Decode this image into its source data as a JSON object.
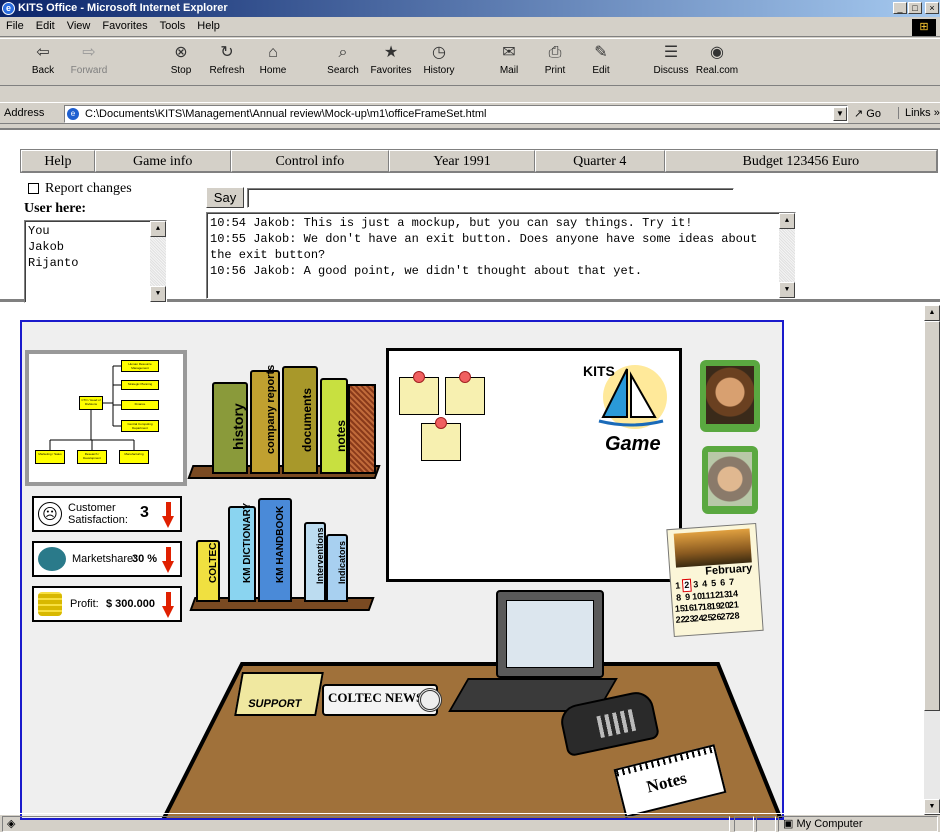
{
  "window": {
    "title": "KITS Office - Microsoft Internet Explorer"
  },
  "menu": [
    "File",
    "Edit",
    "View",
    "Favorites",
    "Tools",
    "Help"
  ],
  "toolbar": [
    {
      "label": "Back",
      "icon": "back-arrow-icon",
      "glyph": "⇦",
      "enabled": true
    },
    {
      "label": "Forward",
      "icon": "forward-arrow-icon",
      "glyph": "⇨",
      "enabled": false
    },
    {
      "label": "Stop",
      "icon": "stop-icon",
      "glyph": "⊗",
      "enabled": true
    },
    {
      "label": "Refresh",
      "icon": "refresh-icon",
      "glyph": "↻",
      "enabled": true
    },
    {
      "label": "Home",
      "icon": "home-icon",
      "glyph": "⌂",
      "enabled": true
    },
    {
      "label": "Search",
      "icon": "search-icon",
      "glyph": "⌕",
      "enabled": true
    },
    {
      "label": "Favorites",
      "icon": "favorites-icon",
      "glyph": "★",
      "enabled": true
    },
    {
      "label": "History",
      "icon": "history-icon",
      "glyph": "◷",
      "enabled": true
    },
    {
      "label": "Mail",
      "icon": "mail-icon",
      "glyph": "✉",
      "enabled": true
    },
    {
      "label": "Print",
      "icon": "print-icon",
      "glyph": "⎙",
      "enabled": true
    },
    {
      "label": "Edit",
      "icon": "edit-icon",
      "glyph": "✎",
      "enabled": true
    },
    {
      "label": "Discuss",
      "icon": "discuss-icon",
      "glyph": "☰",
      "enabled": true
    },
    {
      "label": "Real.com",
      "icon": "realcom-icon",
      "glyph": "◉",
      "enabled": true
    }
  ],
  "address": {
    "label": "Address",
    "url": "C:\\Documents\\KITS\\Management\\Annual review\\Mock-up\\m1\\officeFrameSet.html",
    "go": "Go",
    "links": "Links"
  },
  "nav": {
    "help": "Help",
    "game_info": "Game info",
    "control_info": "Control info",
    "year": "Year 1991",
    "quarter": "Quarter 4",
    "budget": "Budget 123456 Euro"
  },
  "report_changes": "Report changes",
  "users": {
    "label": "User here:",
    "list": [
      "You",
      "Jakob",
      "Rijanto"
    ]
  },
  "say": {
    "button": "Say",
    "value": ""
  },
  "chat": [
    "10:54 Jakob: This is just a mockup, but you can say things. Try it!",
    "10:55 Jakob: We don't have an exit button. Does anyone have some ideas about the exit button?",
    "10:56 Jakob: A good point, we didn't thought about that yet."
  ],
  "office": {
    "books_top": [
      "history",
      "company reports",
      "documents",
      "notes"
    ],
    "books_bottom": [
      "COLTEC",
      "KM DICTIONARY",
      "KM HANDBOOK",
      "Interventions",
      "Indicators"
    ],
    "org_chart": [
      "CTO / Head of Divisions",
      "Human Resource Management",
      "Strategic Planning",
      "Finance",
      "Central Computing Department",
      "Marketing / Sales",
      "Research / Development",
      "Manufacturing"
    ],
    "indicators": {
      "customer_satisfaction": {
        "label": "Customer Satisfaction:",
        "value": "3"
      },
      "marketshare": {
        "label": "Marketshare:",
        "value": "30 %"
      },
      "profit": {
        "label": "Profit:",
        "value": "$ 300.000"
      }
    },
    "whiteboard": {
      "logo": "KITS",
      "subtitle": "Game"
    },
    "calendar": {
      "month": "February",
      "selected": "2",
      "rows": [
        [
          "1",
          "2",
          "3",
          "4",
          "5",
          "6",
          "7"
        ],
        [
          "8",
          "9",
          "10",
          "11",
          "12",
          "13",
          "14"
        ],
        [
          "15",
          "16",
          "17",
          "18",
          "19",
          "20",
          "21"
        ],
        [
          "22",
          "23",
          "24",
          "25",
          "26",
          "27",
          "28"
        ]
      ]
    },
    "desk": {
      "support": "SUPPORT",
      "newspaper": "COLTEC NEWS",
      "notes": "Notes"
    }
  },
  "status": {
    "zone": "My Computer"
  },
  "colors": {
    "title_start": "#0a246a",
    "title_end": "#a6caf0",
    "desk": "#a0713a",
    "board": "#ffffff",
    "frame_border": "#1a1acc",
    "arrow": "#e02000"
  }
}
